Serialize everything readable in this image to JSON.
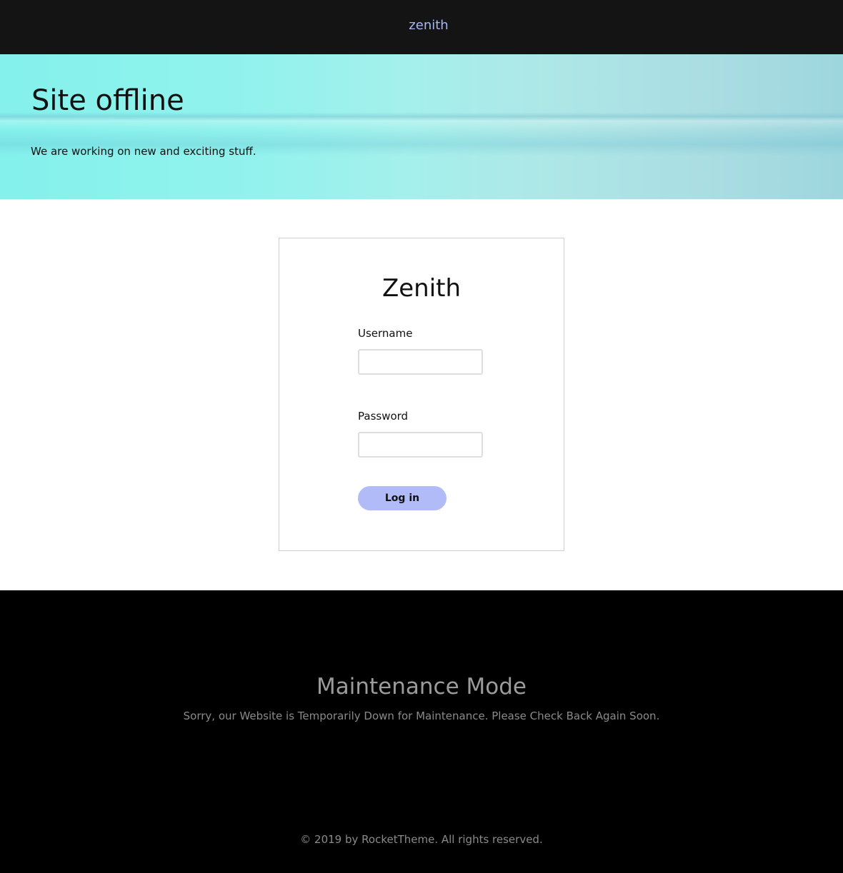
{
  "header": {
    "logo_text": "zenith"
  },
  "hero": {
    "title": "Site offline",
    "message": "We are working on new and exciting stuff."
  },
  "login": {
    "title": "Zenith",
    "username_label": "Username",
    "username_value": "",
    "password_label": "Password",
    "password_value": "",
    "submit_label": "Log in"
  },
  "footer": {
    "title": "Maintenance Mode",
    "message": "Sorry, our Website is Temporarily Down for Maintenance. Please Check Back Again Soon.",
    "copyright": "© 2019 by RocketTheme. All rights reserved."
  },
  "colors": {
    "topbar": "#141414",
    "logo": "#aab7f5",
    "button": "#b0bbf8",
    "footer": "#000000",
    "footer_text": "#8a8a8a"
  }
}
